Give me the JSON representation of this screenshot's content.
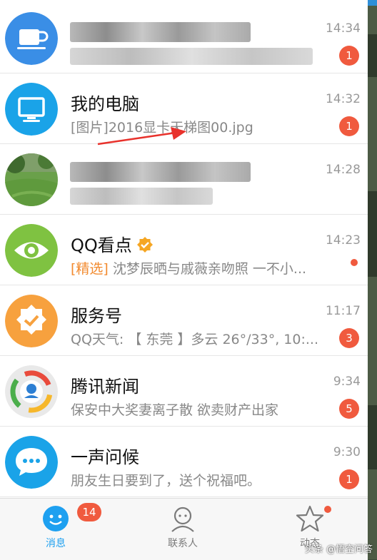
{
  "conversations": [
    {
      "name": "",
      "preview": "",
      "time": "14:34",
      "badge": "1",
      "blurred": true
    },
    {
      "name": "我的电脑",
      "preview": "[图片]2016显卡天梯图00.jpg",
      "time": "14:32",
      "badge": "1"
    },
    {
      "name": "",
      "preview": "",
      "time": "14:28",
      "badge": "",
      "blurred": true
    },
    {
      "name": "QQ看点",
      "preview_tag": "[精选]",
      "preview": " 沈梦辰晒与戚薇亲吻照 一不小...",
      "time": "14:23",
      "dot": true
    },
    {
      "name": "服务号",
      "preview": "QQ天气: 【 东莞 】多云 26°/33°, 10:...",
      "time": "11:17",
      "badge": "3"
    },
    {
      "name": "腾讯新闻",
      "preview": "保安中大奖妻离子散 欲卖财产出家",
      "time": "9:34",
      "badge": "5"
    },
    {
      "name": "一声问候",
      "preview": "朋友生日要到了，送个祝福吧。",
      "time": "9:30",
      "badge": "1"
    }
  ],
  "tabs": [
    {
      "label": "消息",
      "badge": "14",
      "active": true
    },
    {
      "label": "联系人"
    },
    {
      "label": "动态",
      "dot": true
    }
  ],
  "watermark": "头条 @悟空问答",
  "colors": {
    "accent": "#1ea0f0",
    "badge": "#f05a3e",
    "tag": "#f28a2e"
  }
}
